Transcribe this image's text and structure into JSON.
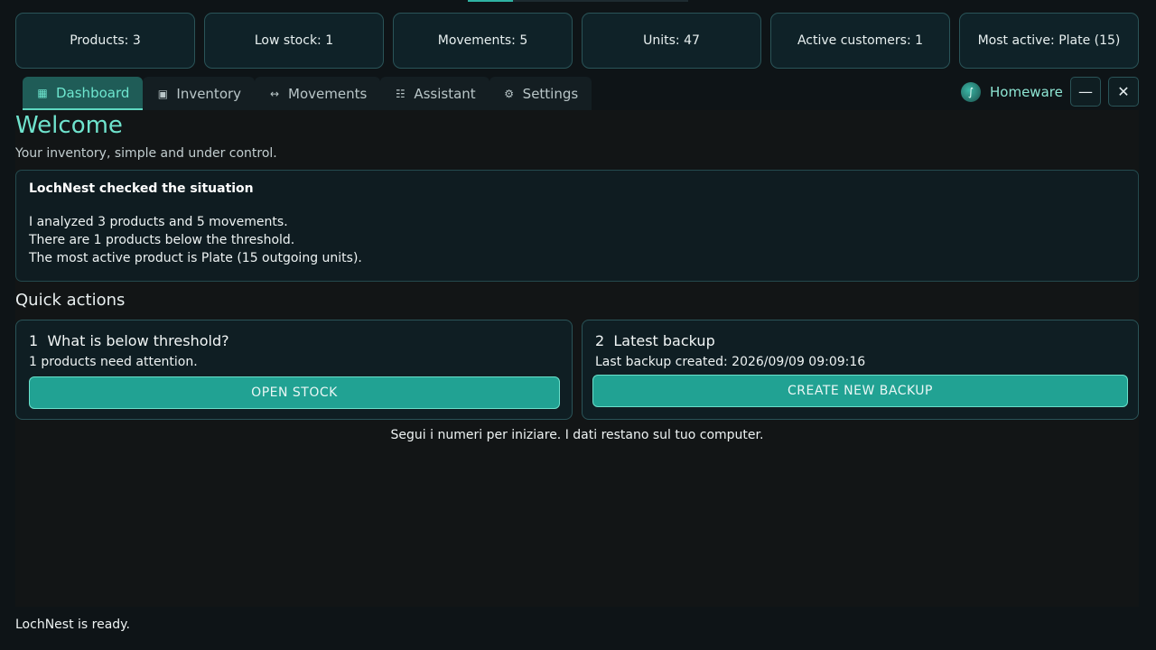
{
  "stats": [
    {
      "label": "Products: 3"
    },
    {
      "label": "Low stock: 1"
    },
    {
      "label": "Movements: 5"
    },
    {
      "label": "Units: 47"
    },
    {
      "label": "Active customers: 1"
    },
    {
      "label": "Most active: Plate (15)"
    }
  ],
  "tabs": [
    {
      "label": "Dashboard",
      "icon": "grid-icon",
      "active": true
    },
    {
      "label": "Inventory",
      "icon": "box-icon",
      "active": false
    },
    {
      "label": "Movements",
      "icon": "arrows-icon",
      "active": false
    },
    {
      "label": "Assistant",
      "icon": "list-icon",
      "active": false
    },
    {
      "label": "Settings",
      "icon": "gear-icon",
      "active": false
    }
  ],
  "brand": {
    "name": "Homeware",
    "logo_icon": "lochnest-logo-icon"
  },
  "window": {
    "minimize_icon": "minimize-icon",
    "close_icon": "close-icon"
  },
  "main": {
    "title": "Welcome",
    "subtitle": "Your inventory, simple and under control.",
    "info": {
      "title": "LochNest checked the situation",
      "lines": [
        "I analyzed 3 products and 5 movements.",
        "There are 1 products below the threshold.",
        "The most active product is Plate (15 outgoing units)."
      ]
    },
    "quick_actions_title": "Quick actions",
    "cards": [
      {
        "number": "1",
        "title": "What is below threshold?",
        "desc": "1 products need attention.",
        "button": "OPEN STOCK"
      },
      {
        "number": "2",
        "title": "Latest backup",
        "desc": "Last backup created: 2026/09/09 09:09:16",
        "button": "CREATE NEW BACKUP"
      }
    ],
    "hint": "Segui i numeri per iniziare. I dati restano sul tuo computer."
  },
  "status": "LochNest is ready.",
  "colors": {
    "accent": "#6fe3cd",
    "button": "#21a293",
    "background": "#0e1417"
  }
}
